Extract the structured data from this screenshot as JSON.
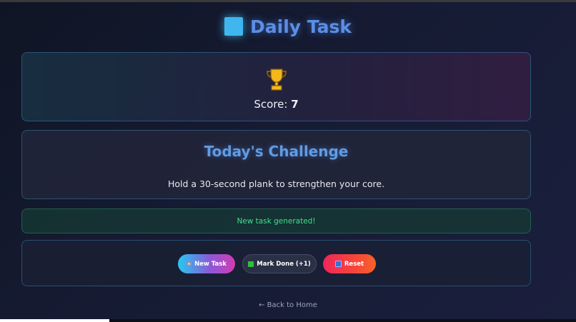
{
  "header": {
    "title": "Daily Task",
    "title_icon": "blue-square-icon"
  },
  "score": {
    "icon": "trophy-icon",
    "label": "Score:",
    "value": "7"
  },
  "challenge": {
    "title": "Today's Challenge",
    "text": "Hold a 30-second plank to strengthen your core."
  },
  "status": {
    "message": "New task generated!"
  },
  "buttons": {
    "new_task": {
      "icon": "gear-icon",
      "label": "New Task"
    },
    "mark_done": {
      "icon": "check-icon",
      "label": "Mark Done (+1)"
    },
    "reset": {
      "icon": "refresh-icon",
      "label": "Reset"
    }
  },
  "footer": {
    "back_link": "← Back to Home"
  },
  "colors": {
    "accent": "#5b8ee6",
    "status_green": "#3fe08a",
    "reset_red": "#f0265a"
  }
}
